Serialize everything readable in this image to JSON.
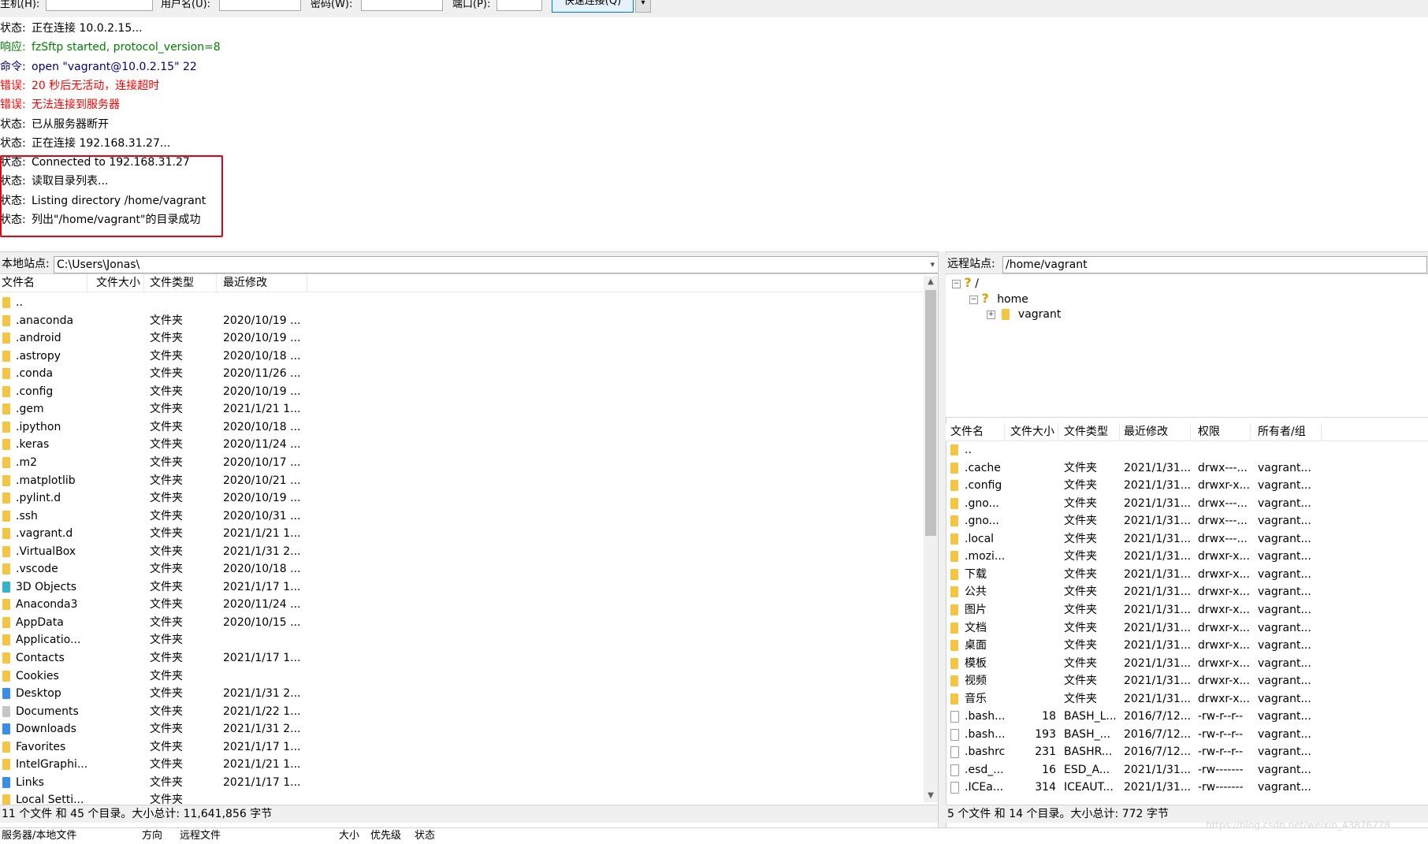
{
  "quickconnect": {
    "host_label": "主机(H):",
    "user_label": "用户名(U):",
    "pass_label": "密码(W):",
    "port_label": "端口(P):",
    "connect_button": "快速连接(Q)",
    "dropdown": "▾"
  },
  "log": [
    {
      "prefix": "状态:",
      "text": "正在连接 10.0.2.15...",
      "kind": "st"
    },
    {
      "prefix": "响应:",
      "text": "fzSftp started, protocol_version=8",
      "kind": "rsp"
    },
    {
      "prefix": "命令:",
      "text": "open \"vagrant@10.0.2.15\" 22",
      "kind": "cmd"
    },
    {
      "prefix": "错误:",
      "text": "20 秒后无活动，连接超时",
      "kind": "err"
    },
    {
      "prefix": "错误:",
      "text": "无法连接到服务器",
      "kind": "err"
    },
    {
      "prefix": "状态:",
      "text": "已从服务器断开",
      "kind": "st"
    },
    {
      "prefix": "状态:",
      "text": "正在连接 192.168.31.27...",
      "kind": "st"
    },
    {
      "prefix": "状态:",
      "text": "Connected to 192.168.31.27",
      "kind": "st"
    },
    {
      "prefix": "状态:",
      "text": "读取目录列表...",
      "kind": "st"
    },
    {
      "prefix": "状态:",
      "text": "Listing directory /home/vagrant",
      "kind": "st"
    },
    {
      "prefix": "状态:",
      "text": "列出\"/home/vagrant\"的目录成功",
      "kind": "st"
    }
  ],
  "local": {
    "site_label": "本地站点:",
    "path": "C:\\Users\\Jonas\\",
    "headers": {
      "name": "文件名",
      "size": "文件大小",
      "type": "文件类型",
      "modified": "最近修改"
    },
    "rows": [
      {
        "name": "..",
        "size": "",
        "type": "",
        "modified": "",
        "icon": "folder"
      },
      {
        "name": ".anaconda",
        "size": "",
        "type": "文件夹",
        "modified": "2020/10/19 ...",
        "icon": "folder"
      },
      {
        "name": ".android",
        "size": "",
        "type": "文件夹",
        "modified": "2020/10/19 ...",
        "icon": "folder"
      },
      {
        "name": ".astropy",
        "size": "",
        "type": "文件夹",
        "modified": "2020/10/18 ...",
        "icon": "folder"
      },
      {
        "name": ".conda",
        "size": "",
        "type": "文件夹",
        "modified": "2020/11/26 ...",
        "icon": "folder"
      },
      {
        "name": ".config",
        "size": "",
        "type": "文件夹",
        "modified": "2020/10/19 ...",
        "icon": "folder"
      },
      {
        "name": ".gem",
        "size": "",
        "type": "文件夹",
        "modified": "2021/1/21 1...",
        "icon": "folder"
      },
      {
        "name": ".ipython",
        "size": "",
        "type": "文件夹",
        "modified": "2020/10/18 ...",
        "icon": "folder"
      },
      {
        "name": ".keras",
        "size": "",
        "type": "文件夹",
        "modified": "2020/11/24 ...",
        "icon": "folder"
      },
      {
        "name": ".m2",
        "size": "",
        "type": "文件夹",
        "modified": "2020/10/17 ...",
        "icon": "folder"
      },
      {
        "name": ".matplotlib",
        "size": "",
        "type": "文件夹",
        "modified": "2020/10/21 ...",
        "icon": "folder"
      },
      {
        "name": ".pylint.d",
        "size": "",
        "type": "文件夹",
        "modified": "2020/10/19 ...",
        "icon": "folder"
      },
      {
        "name": ".ssh",
        "size": "",
        "type": "文件夹",
        "modified": "2020/10/31 ...",
        "icon": "folder"
      },
      {
        "name": ".vagrant.d",
        "size": "",
        "type": "文件夹",
        "modified": "2021/1/21 1...",
        "icon": "folder"
      },
      {
        "name": ".VirtualBox",
        "size": "",
        "type": "文件夹",
        "modified": "2021/1/31 2...",
        "icon": "folder"
      },
      {
        "name": ".vscode",
        "size": "",
        "type": "文件夹",
        "modified": "2020/10/18 ...",
        "icon": "folder"
      },
      {
        "name": "3D Objects",
        "size": "",
        "type": "文件夹",
        "modified": "2021/1/17 1...",
        "icon": "teal"
      },
      {
        "name": "Anaconda3",
        "size": "",
        "type": "文件夹",
        "modified": "2020/11/24 ...",
        "icon": "folder"
      },
      {
        "name": "AppData",
        "size": "",
        "type": "文件夹",
        "modified": "2020/10/15 ...",
        "icon": "folder"
      },
      {
        "name": "Applicatio...",
        "size": "",
        "type": "文件夹",
        "modified": "",
        "icon": "folder"
      },
      {
        "name": "Contacts",
        "size": "",
        "type": "文件夹",
        "modified": "2021/1/17 1...",
        "icon": "folder"
      },
      {
        "name": "Cookies",
        "size": "",
        "type": "文件夹",
        "modified": "",
        "icon": "folder"
      },
      {
        "name": "Desktop",
        "size": "",
        "type": "文件夹",
        "modified": "2021/1/31 2...",
        "icon": "blue"
      },
      {
        "name": "Documents",
        "size": "",
        "type": "文件夹",
        "modified": "2021/1/22 1...",
        "icon": "gray"
      },
      {
        "name": "Downloads",
        "size": "",
        "type": "文件夹",
        "modified": "2021/1/31 2...",
        "icon": "blue"
      },
      {
        "name": "Favorites",
        "size": "",
        "type": "文件夹",
        "modified": "2021/1/17 1...",
        "icon": "folder"
      },
      {
        "name": "IntelGraphi...",
        "size": "",
        "type": "文件夹",
        "modified": "2021/1/21 1...",
        "icon": "folder"
      },
      {
        "name": "Links",
        "size": "",
        "type": "文件夹",
        "modified": "2021/1/17 1...",
        "icon": "blue"
      },
      {
        "name": "Local Setti...",
        "size": "",
        "type": "文件夹",
        "modified": "",
        "icon": "folder"
      }
    ],
    "status": "11 个文件 和 45 个目录。大小总计: 11,641,856 字节"
  },
  "remote": {
    "site_label": "远程站点:",
    "path": "/home/vagrant",
    "tree": [
      {
        "label": "/",
        "toggle": "⊟",
        "icon": "?"
      },
      {
        "label": "home",
        "toggle": "⊟",
        "icon": "?"
      },
      {
        "label": "vagrant",
        "toggle": "⊞",
        "icon": "folder"
      }
    ],
    "headers": {
      "name": "文件名",
      "size": "文件大小",
      "type": "文件类型",
      "modified": "最近修改",
      "perm": "权限",
      "owner": "所有者/组"
    },
    "rows": [
      {
        "name": "..",
        "size": "",
        "type": "",
        "modified": "",
        "perm": "",
        "owner": "",
        "icon": "folder"
      },
      {
        "name": ".cache",
        "size": "",
        "type": "文件夹",
        "modified": "2021/1/31...",
        "perm": "drwx---...",
        "owner": "vagrant...",
        "icon": "folder"
      },
      {
        "name": ".config",
        "size": "",
        "type": "文件夹",
        "modified": "2021/1/31...",
        "perm": "drwxr-x...",
        "owner": "vagrant...",
        "icon": "folder"
      },
      {
        "name": ".gno...",
        "size": "",
        "type": "文件夹",
        "modified": "2021/1/31...",
        "perm": "drwx---...",
        "owner": "vagrant...",
        "icon": "folder"
      },
      {
        "name": ".gno...",
        "size": "",
        "type": "文件夹",
        "modified": "2021/1/31...",
        "perm": "drwx---...",
        "owner": "vagrant...",
        "icon": "folder"
      },
      {
        "name": ".local",
        "size": "",
        "type": "文件夹",
        "modified": "2021/1/31...",
        "perm": "drwx---...",
        "owner": "vagrant...",
        "icon": "folder"
      },
      {
        "name": ".mozi...",
        "size": "",
        "type": "文件夹",
        "modified": "2021/1/31...",
        "perm": "drwxr-x...",
        "owner": "vagrant...",
        "icon": "folder"
      },
      {
        "name": "下载",
        "size": "",
        "type": "文件夹",
        "modified": "2021/1/31...",
        "perm": "drwxr-x...",
        "owner": "vagrant...",
        "icon": "folder"
      },
      {
        "name": "公共",
        "size": "",
        "type": "文件夹",
        "modified": "2021/1/31...",
        "perm": "drwxr-x...",
        "owner": "vagrant...",
        "icon": "folder"
      },
      {
        "name": "图片",
        "size": "",
        "type": "文件夹",
        "modified": "2021/1/31...",
        "perm": "drwxr-x...",
        "owner": "vagrant...",
        "icon": "folder"
      },
      {
        "name": "文档",
        "size": "",
        "type": "文件夹",
        "modified": "2021/1/31...",
        "perm": "drwxr-x...",
        "owner": "vagrant...",
        "icon": "folder"
      },
      {
        "name": "桌面",
        "size": "",
        "type": "文件夹",
        "modified": "2021/1/31...",
        "perm": "drwxr-x...",
        "owner": "vagrant...",
        "icon": "folder"
      },
      {
        "name": "模板",
        "size": "",
        "type": "文件夹",
        "modified": "2021/1/31...",
        "perm": "drwxr-x...",
        "owner": "vagrant...",
        "icon": "folder"
      },
      {
        "name": "视频",
        "size": "",
        "type": "文件夹",
        "modified": "2021/1/31...",
        "perm": "drwxr-x...",
        "owner": "vagrant...",
        "icon": "folder"
      },
      {
        "name": "音乐",
        "size": "",
        "type": "文件夹",
        "modified": "2021/1/31...",
        "perm": "drwxr-x...",
        "owner": "vagrant...",
        "icon": "folder"
      },
      {
        "name": ".bash...",
        "size": "18",
        "type": "BASH_L...",
        "modified": "2016/7/12...",
        "perm": "-rw-r--r--",
        "owner": "vagrant...",
        "icon": "file"
      },
      {
        "name": ".bash...",
        "size": "193",
        "type": "BASH_...",
        "modified": "2016/7/12...",
        "perm": "-rw-r--r--",
        "owner": "vagrant...",
        "icon": "file"
      },
      {
        "name": ".bashrc",
        "size": "231",
        "type": "BASHR...",
        "modified": "2016/7/12...",
        "perm": "-rw-r--r--",
        "owner": "vagrant...",
        "icon": "file"
      },
      {
        "name": ".esd_...",
        "size": "16",
        "type": "ESD_A...",
        "modified": "2021/1/31...",
        "perm": "-rw-------",
        "owner": "vagrant...",
        "icon": "file"
      },
      {
        "name": ".ICEa...",
        "size": "314",
        "type": "ICEAUT...",
        "modified": "2021/1/31...",
        "perm": "-rw-------",
        "owner": "vagrant...",
        "icon": "file"
      }
    ],
    "status": "5 个文件 和 14 个目录。大小总计: 772 字节"
  },
  "queue": {
    "col_server": "服务器/本地文件",
    "col_direction": "方向",
    "col_remote": "远程文件",
    "col_size": "大小",
    "col_priority": "优先级",
    "col_status": "状态"
  },
  "watermark": "https://blog.csdn.net/weixin_43876778"
}
